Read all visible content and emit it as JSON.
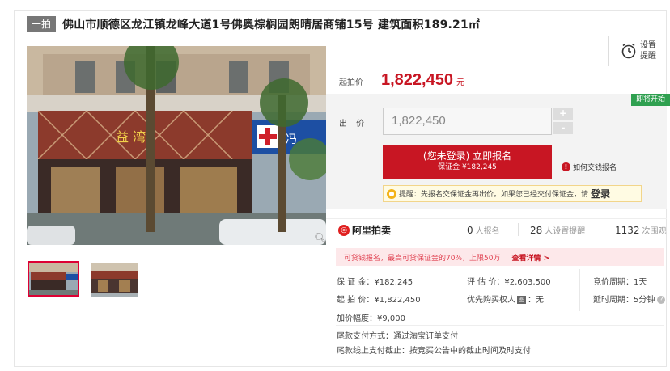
{
  "header": {
    "tag": "一拍",
    "title": "佛山市顺德区龙江镇龙峰大道1号佛奥棕榈园朗晴居商铺15号 建筑面积189.21㎡"
  },
  "remind": {
    "label_line1": "设置",
    "label_line2": "提醒"
  },
  "price": {
    "start_label": "起拍价",
    "start_value": "1,822,450",
    "unit": "元",
    "status": "即将开始"
  },
  "bid": {
    "label": "出 价",
    "value": "1,822,450",
    "plus": "+",
    "minus": "-"
  },
  "register": {
    "main": "(您未登录) 立即报名",
    "sub": "保证金 ¥182,245",
    "howto": "如何交钱报名"
  },
  "tip": {
    "text": "提醒：先报名交保证金再出价。如果您已经交付保证金，请",
    "login": "登录"
  },
  "stats": {
    "brand": "阿里拍卖",
    "signup_count": "0",
    "signup_label": "人报名",
    "remind_count": "28",
    "remind_label": "人设置提醒",
    "view_count": "1132",
    "view_label": "次围观"
  },
  "loan": {
    "text": "可贷钱报名，最高可贷保证金的70%，上限50万",
    "link": "查看详情 >"
  },
  "details": {
    "deposit_k": "保 证 金：",
    "deposit_v": "¥182,245",
    "appraisal_k": "评 估 价：",
    "appraisal_v": "¥2,603,500",
    "cycle_k": "竞价周期：",
    "cycle_v": "1天",
    "start_k": "起 拍 价：",
    "start_v": "¥1,822,450",
    "priority_k": "优先购买权人",
    "priority_badge": "图",
    "priority_v": "：无",
    "delay_k": "延时周期：",
    "delay_v": "5分钟",
    "increment_k": "加价幅度：",
    "increment_v": "¥9,000",
    "payment_k": "尾款支付方式：",
    "payment_v": "通过淘宝订单支付",
    "offline_k": "尾款线上支付截止：",
    "offline_v": "按竞买公告中的截止时间及时支付"
  },
  "store_sign": {
    "left_chars": "益 湾",
    "cross_text": "冯"
  },
  "colors": {
    "accent": "#c81623",
    "status": "#2fa050"
  }
}
